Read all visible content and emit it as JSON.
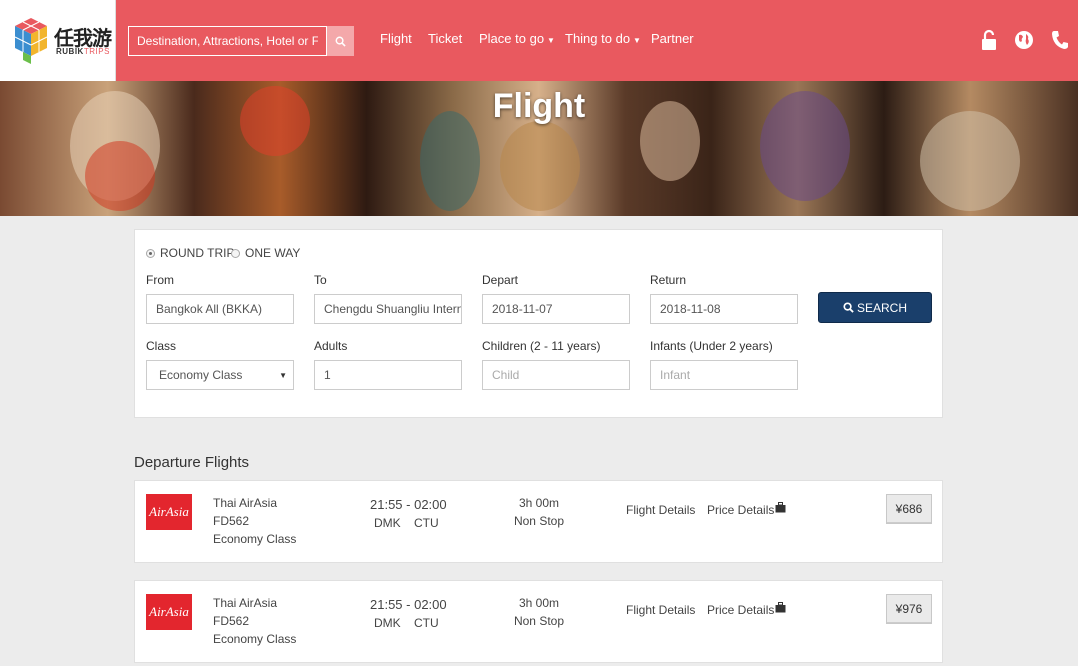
{
  "header": {
    "logo_cn": "任我游",
    "logo_en_1": "RUBIK",
    "logo_en_2": "TRIPS",
    "search_placeholder": "Destination, Attractions, Hotel or Flight",
    "nav": [
      {
        "label": "Flight",
        "dropdown": false
      },
      {
        "label": "Ticket",
        "dropdown": false
      },
      {
        "label": "Place to go",
        "dropdown": true
      },
      {
        "label": "Thing to do",
        "dropdown": true
      },
      {
        "label": "Partner",
        "dropdown": false
      }
    ],
    "icons": [
      "lock-icon",
      "globe-icon",
      "phone-icon"
    ],
    "bar_color": "#e9595f"
  },
  "banner": {
    "title": "Flight"
  },
  "form": {
    "trip_types": [
      {
        "label": "ROUND TRIP",
        "selected": true
      },
      {
        "label": "ONE WAY",
        "selected": false
      }
    ],
    "from_label": "From",
    "from_value": "Bangkok All (BKKA)",
    "to_label": "To",
    "to_value": "Chengdu Shuangliu Internat",
    "depart_label": "Depart",
    "depart_value": "2018-11-07",
    "return_label": "Return",
    "return_value": "2018-11-08",
    "search_label": "SEARCH",
    "class_label": "Class",
    "class_value": "Economy Class",
    "adults_label": "Adults",
    "adults_value": "1",
    "children_label": "Children (2 - 11 years)",
    "children_placeholder": "Child",
    "infants_label": "Infants (Under 2 years)",
    "infants_placeholder": "Infant",
    "button_color": "#1a3f6b"
  },
  "results": {
    "title": "Departure Flights",
    "flights": [
      {
        "airline_logo": "AirAsia",
        "airline": "Thai AirAsia",
        "flight_no": "FD562",
        "cabin": "Economy Class",
        "time": "21:55 - 02:00",
        "origin": "DMK",
        "destination": "CTU",
        "duration": "3h 00m",
        "stops": "Non Stop",
        "details_link": "Flight Details",
        "price_link": "Price Details",
        "price": "¥686"
      },
      {
        "airline_logo": "AirAsia",
        "airline": "Thai AirAsia",
        "flight_no": "FD562",
        "cabin": "Economy Class",
        "time": "21:55 - 02:00",
        "origin": "DMK",
        "destination": "CTU",
        "duration": "3h 00m",
        "stops": "Non Stop",
        "details_link": "Flight Details",
        "price_link": "Price Details",
        "price": "¥976"
      }
    ]
  }
}
